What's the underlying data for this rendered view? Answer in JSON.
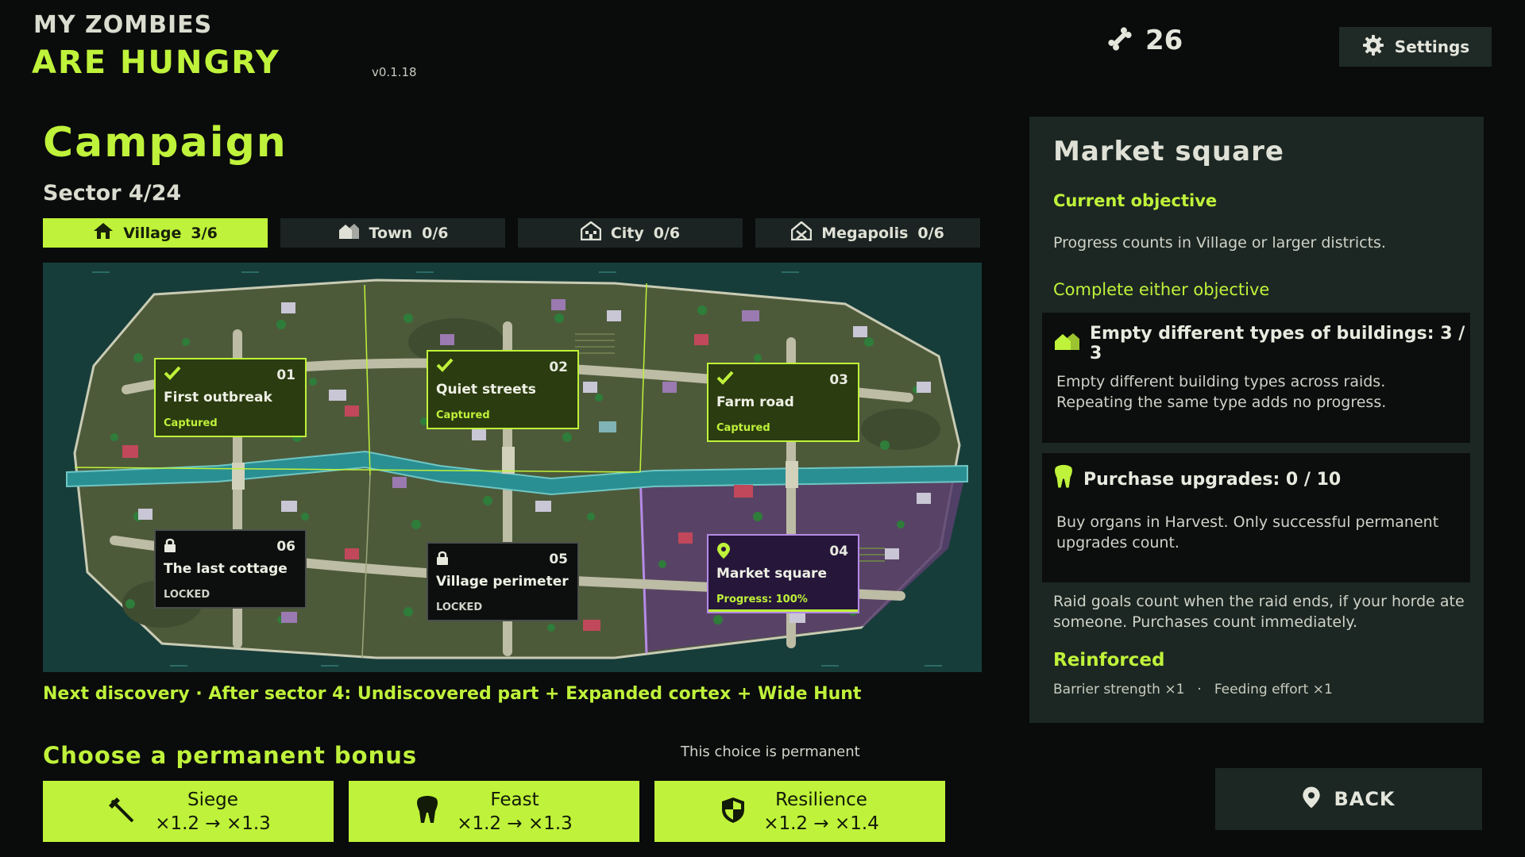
{
  "header": {
    "logo_line1": "MY ZOMBIES",
    "logo_line2": "ARE HUNGRY",
    "version": "v0.1.18",
    "bones": "26",
    "settings_label": "Settings"
  },
  "campaign": {
    "title": "Campaign",
    "sector": "Sector 4/24",
    "tabs": [
      {
        "label": "Village",
        "count": "3/6",
        "icon": "house-icon",
        "active": true
      },
      {
        "label": "Town",
        "count": "0/6",
        "icon": "town-icon",
        "active": false
      },
      {
        "label": "City",
        "count": "0/6",
        "icon": "city-icon",
        "active": false
      },
      {
        "label": "Megapolis",
        "count": "0/6",
        "icon": "megapolis-icon",
        "active": false
      }
    ],
    "nodes": [
      {
        "num": "01",
        "name": "First outbreak",
        "status": "Captured",
        "state": "captured"
      },
      {
        "num": "02",
        "name": "Quiet streets",
        "status": "Captured",
        "state": "captured"
      },
      {
        "num": "03",
        "name": "Farm road",
        "status": "Captured",
        "state": "captured"
      },
      {
        "num": "04",
        "name": "Market square",
        "status": "Progress: 100%",
        "state": "current",
        "progress": 1.0
      },
      {
        "num": "05",
        "name": "Village perimeter",
        "status": "LOCKED",
        "state": "locked"
      },
      {
        "num": "06",
        "name": "The last cottage",
        "status": "LOCKED",
        "state": "locked"
      }
    ],
    "next_discovery": "Next discovery · After sector 4: Undiscovered part + Expanded cortex + Wide Hunt"
  },
  "bonus": {
    "title": "Choose a permanent bonus",
    "note": "This choice is permanent",
    "options": [
      {
        "name": "Siege",
        "value": "×1.2 → ×1.3",
        "icon": "hammer-icon"
      },
      {
        "name": "Feast",
        "value": "×1.2 → ×1.3",
        "icon": "tooth-icon"
      },
      {
        "name": "Resilience",
        "value": "×1.2 → ×1.4",
        "icon": "shield-icon"
      }
    ]
  },
  "panel": {
    "title": "Market square",
    "current_objective_label": "Current objective",
    "current_objective_text": "Progress counts in Village or larger districts.",
    "either_label": "Complete either objective",
    "objectives": [
      {
        "title": "Empty different types of buildings: 3 / 3",
        "desc": "Empty different building types across raids. Repeating the same type adds no progress.",
        "icon": "building-icon"
      },
      {
        "title": "Purchase upgrades: 0 / 10",
        "desc": "Buy organs in Harvest. Only successful permanent upgrades count.",
        "icon": "tooth-icon"
      }
    ],
    "raid_note": "Raid goals count when the raid ends, if your horde ate someone. Purchases count immediately.",
    "reinforced_label": "Reinforced",
    "reinforced_stats": [
      "Barrier strength ×1",
      "·",
      "Feeding effort ×1"
    ]
  },
  "back_label": "BACK",
  "colors": {
    "accent": "#bff23a",
    "panel": "#1c2723",
    "map_water": "#173d3a",
    "land": "#4d5a3a",
    "current_sector": "#b58ae6"
  }
}
